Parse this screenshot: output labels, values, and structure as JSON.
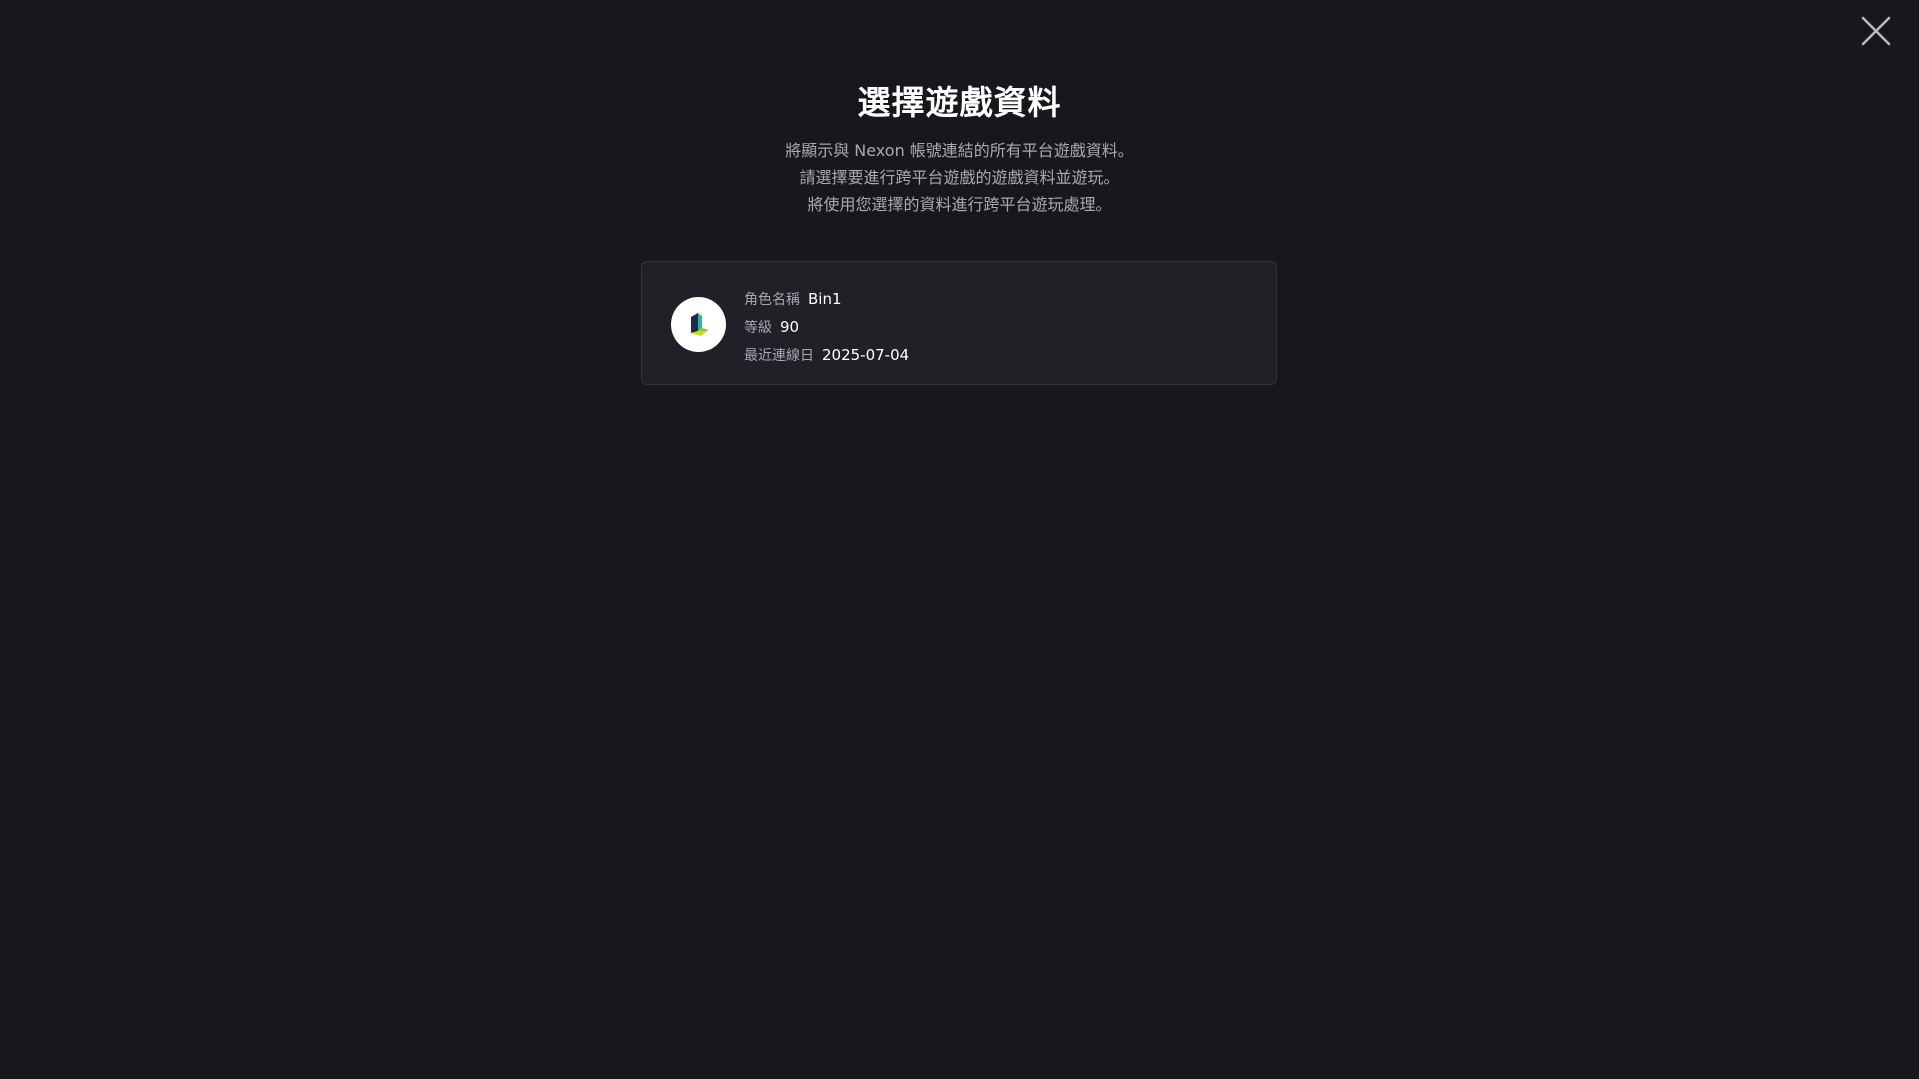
{
  "page": {
    "title": "選擇遊戲資料",
    "description": [
      "將顯示與 Nexon 帳號連結的所有平台遊戲資料。",
      "請選擇要進行跨平台遊戲的遊戲資料並遊玩。",
      "將使用您選擇的資料進行跨平台遊玩處理。"
    ]
  },
  "close": {
    "icon": "close-icon"
  },
  "profile_card": {
    "icon": "game-logo-icon",
    "character_name_label": "角色名稱",
    "character_name": "Bin1",
    "level_label": "等級",
    "level": "90",
    "last_login_label": "最近連線日",
    "last_login": "2025-07-04"
  },
  "colors": {
    "background": "#17171c",
    "card_background": "#202027",
    "card_border": "#34343c",
    "text_primary": "#ffffff",
    "text_secondary": "#a9a9b0",
    "logo_dark": "#1e2a4a",
    "logo_teal": "#2bb3a6",
    "logo_lime": "#c8e00f"
  }
}
